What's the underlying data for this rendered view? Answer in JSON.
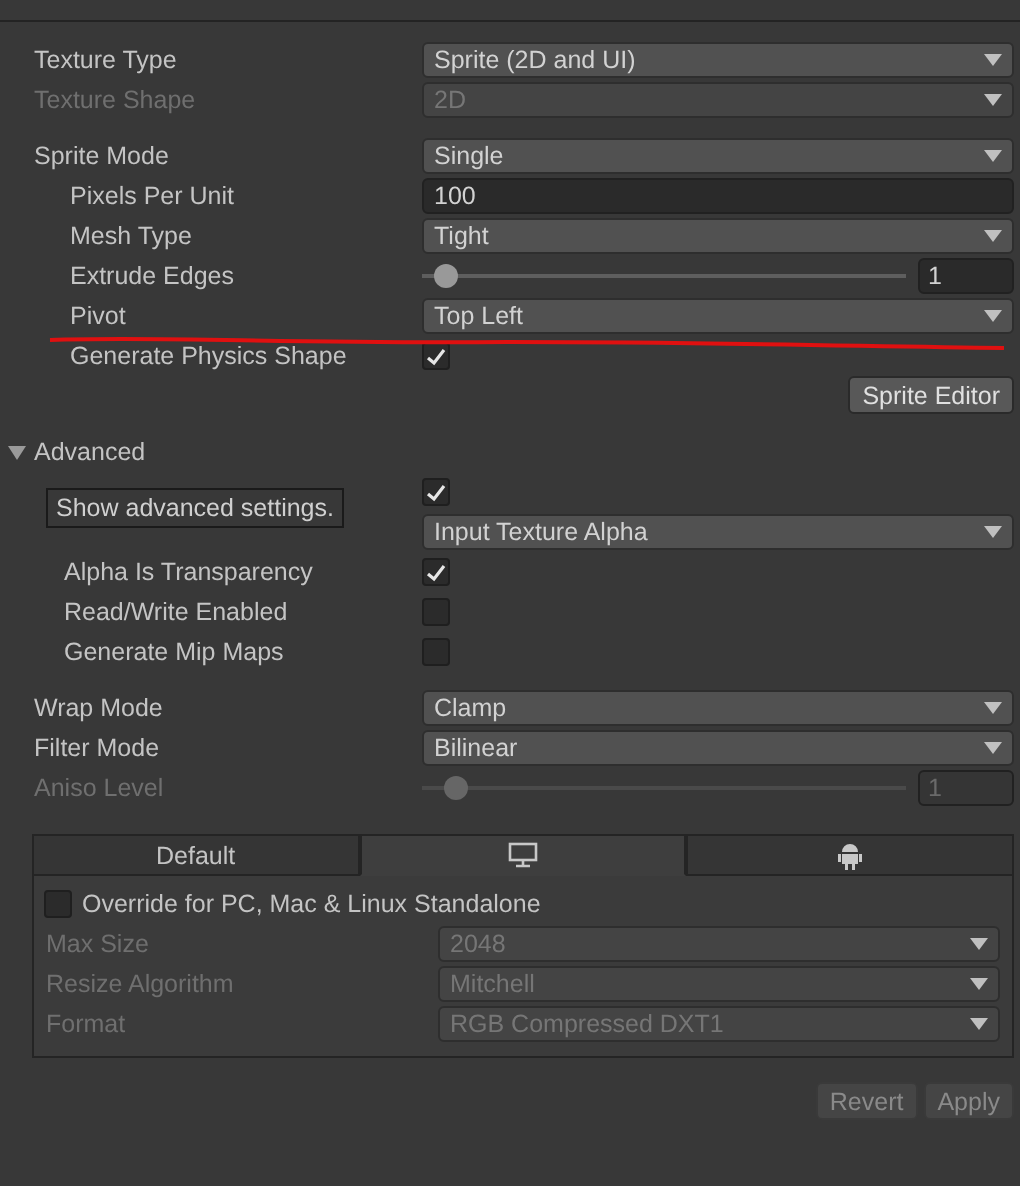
{
  "sections": [
    {
      "properties": [
        {
          "kind": "dropdown",
          "label": "Texture Type",
          "value": "Sprite (2D and UI)",
          "disabled": false
        },
        {
          "kind": "dropdown",
          "label": "Texture Shape",
          "value": "2D",
          "disabled": true
        }
      ]
    },
    {
      "properties": [
        {
          "kind": "dropdown",
          "label": "Sprite Mode",
          "value": "Single",
          "disabled": false,
          "children": [
            {
              "kind": "text",
              "label": "Pixels Per Unit",
              "value": "100",
              "disabled": false
            },
            {
              "kind": "dropdown",
              "label": "Mesh Type",
              "value": "Tight",
              "disabled": false
            },
            {
              "kind": "slider",
              "label": "Extrude Edges",
              "value": "1",
              "level": 0.05,
              "disabled": false
            },
            {
              "kind": "dropdown",
              "label": "Pivot",
              "value": "Top Left",
              "disabled": false
            },
            {
              "kind": "checkbox",
              "label": "Generate Physics Shape",
              "checked": true
            }
          ]
        }
      ]
    }
  ],
  "sprite_editor_button": {
    "label": "Sprite Editor",
    "disabled": false
  },
  "advanced": {
    "label": "Advanced",
    "expanded": true,
    "children": [
      {
        "kind": "checkbox",
        "checked": true
      },
      {
        "kind": "dropdown",
        "value": "Input Texture Alpha",
        "disabled": false
      },
      {
        "kind": "checkbox",
        "label": "Alpha Is Transparency",
        "checked": true
      },
      {
        "kind": "checkbox",
        "label": "Read/Write Enabled",
        "checked": false
      },
      {
        "kind": "checkbox",
        "label": "Generate Mip Maps",
        "checked": false
      }
    ]
  },
  "tooltip": "Show advanced settings.",
  "sampling": {
    "properties": [
      {
        "kind": "dropdown",
        "label": "Wrap Mode",
        "value": "Clamp",
        "disabled": false
      },
      {
        "kind": "dropdown",
        "label": "Filter Mode",
        "value": "Bilinear",
        "disabled": false
      },
      {
        "kind": "slider",
        "label": "Aniso Level",
        "value": "1",
        "level": 0.07,
        "disabled": true
      }
    ]
  },
  "platform_tabs": [
    {
      "kind": "text",
      "label": "Default",
      "selected": false
    },
    {
      "kind": "icon",
      "selected": true
    },
    {
      "kind": "icon",
      "selected": false
    }
  ],
  "platform": {
    "override": {
      "label": "Override for PC, Mac & Linux Standalone",
      "checked": false
    },
    "properties": [
      {
        "kind": "dropdown",
        "label": "Max Size",
        "value": "2048",
        "disabled": true
      },
      {
        "kind": "dropdown",
        "label": "Resize Algorithm",
        "value": "Mitchell",
        "disabled": true
      },
      {
        "kind": "dropdown",
        "label": "Format",
        "value": "RGB Compressed DXT1",
        "disabled": true
      }
    ]
  },
  "buttons": [
    {
      "label": "Revert",
      "disabled": true
    },
    {
      "label": "Apply",
      "disabled": true
    }
  ]
}
